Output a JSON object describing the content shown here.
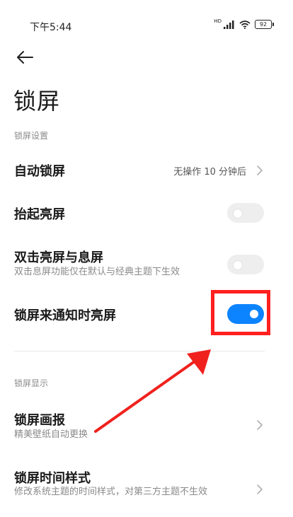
{
  "status_bar": {
    "time": "下午5:44",
    "signal_label": "HD",
    "battery": "92"
  },
  "header": {
    "title": "锁屏"
  },
  "sections": {
    "settings_label": "锁屏设置",
    "display_label": "锁屏显示"
  },
  "settings": {
    "auto_lock": {
      "title": "自动锁屏",
      "value": "无操作 10 分钟后"
    },
    "raise_to_wake": {
      "title": "抬起亮屏",
      "enabled": false
    },
    "double_tap": {
      "title": "双击亮屏与息屏",
      "subtitle": "双击息屏功能仅在默认与经典主题下生效",
      "enabled": false
    },
    "notify_wake": {
      "title": "锁屏来通知时亮屏",
      "enabled": true
    }
  },
  "display": {
    "wallpaper": {
      "title": "锁屏画报",
      "subtitle": "精美壁纸自动更换"
    },
    "clock_style": {
      "title": "锁屏时间样式",
      "subtitle": "修改系统主题的时间样式，对第三方主题不生效"
    }
  },
  "colors": {
    "accent": "#0d84ff",
    "highlight": "#ff2020"
  },
  "icons": [
    "back-arrow-icon",
    "signal-icon",
    "wifi-icon",
    "battery-icon",
    "chevron-right-icon"
  ]
}
